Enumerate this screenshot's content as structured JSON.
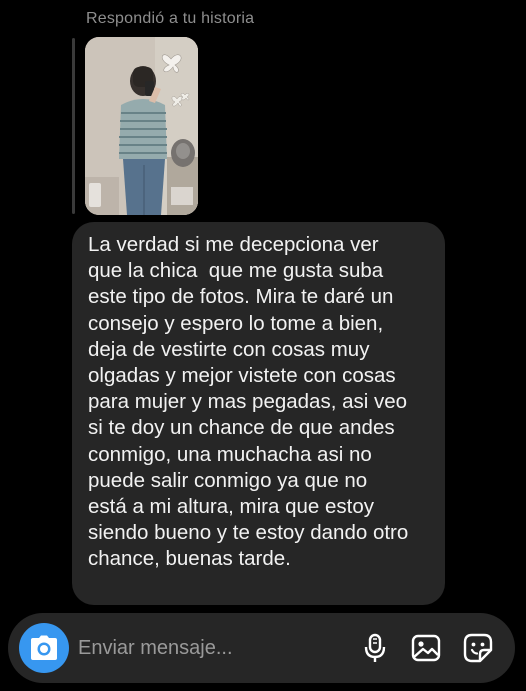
{
  "reply": {
    "label": "Respondió a tu historia"
  },
  "message": {
    "lines": [
      "La verdad si me decepciona ver",
      "que la chica  que me gusta suba",
      "este tipo de fotos. Mira te daré un",
      "consejo y espero lo tome a bien,",
      "deja de vestirte con cosas muy",
      "olgadas y mejor vistete con cosas",
      "para mujer y mas pegadas, asi veo",
      "si te doy un chance de que andes",
      "conmigo, una muchacha asi no",
      "puede salir conmigo ya que no",
      "está a mi altura, mira que estoy",
      "siendo bueno y te estoy dando otro",
      "chance, buenas tarde."
    ]
  },
  "composer": {
    "placeholder": "Enviar mensaje...",
    "value": ""
  },
  "icons": {
    "camera": "camera-icon",
    "mic": "microphone-icon",
    "gallery": "gallery-icon",
    "sticker": "sticker-icon"
  },
  "colors": {
    "background": "#000000",
    "bubble": "#262626",
    "accent": "#3797f0",
    "muted_text": "#8e8e8e"
  }
}
